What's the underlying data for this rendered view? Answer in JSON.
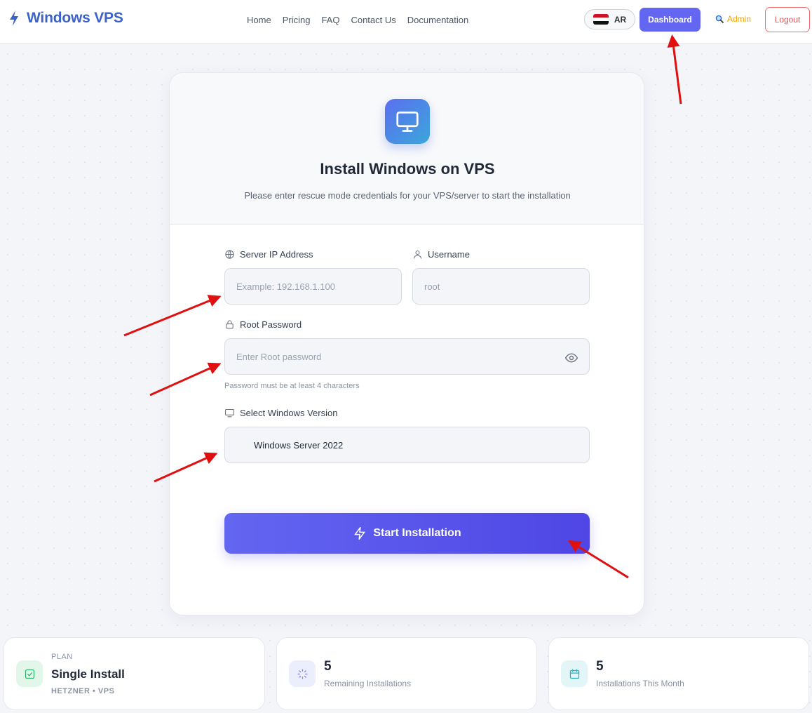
{
  "nav": {
    "brand": "Windows VPS",
    "links": [
      "Home",
      "Pricing",
      "FAQ",
      "Contact Us",
      "Documentation"
    ],
    "lang_label": "AR",
    "dashboard_label": "Dashboard",
    "admin_label": "Admin",
    "logout_label": "Logout"
  },
  "form": {
    "title": "Install Windows on VPS",
    "subtitle": "Please enter rescue mode credentials for your VPS/server to start the installation",
    "ip_label": "Server IP Address",
    "ip_placeholder": "Example: 192.168.1.100",
    "username_label": "Username",
    "username_placeholder": "root",
    "password_label": "Root Password",
    "password_placeholder": "Enter Root password",
    "password_hint": "Password must be at least 4 characters",
    "version_label": "Select Windows Version",
    "version_value": "Windows Server 2022",
    "submit_label": "Start Installation"
  },
  "stats": {
    "plan_caption": "PLAN",
    "plan_name": "Single Install",
    "plan_sub": "HETZNER • VPS",
    "remaining_value": "5",
    "remaining_label": "Remaining Installations",
    "month_value": "5",
    "month_label": "Installations This Month"
  },
  "colors": {
    "brand": "#3b63c8",
    "primary": "#6366f1",
    "admin": "#f0a500",
    "logout": "#e25555",
    "annotation_arrow": "#e01010"
  },
  "icons": {
    "brand": "bolt-icon",
    "header": "monitor-icon",
    "ip": "globe-icon",
    "username": "user-icon",
    "password": "lock-icon",
    "toggle": "eye-icon",
    "version": "monitor-icon",
    "submit": "bolt-icon",
    "plan": "check-square-icon",
    "remaining": "loader-icon",
    "month": "calendar-icon"
  }
}
